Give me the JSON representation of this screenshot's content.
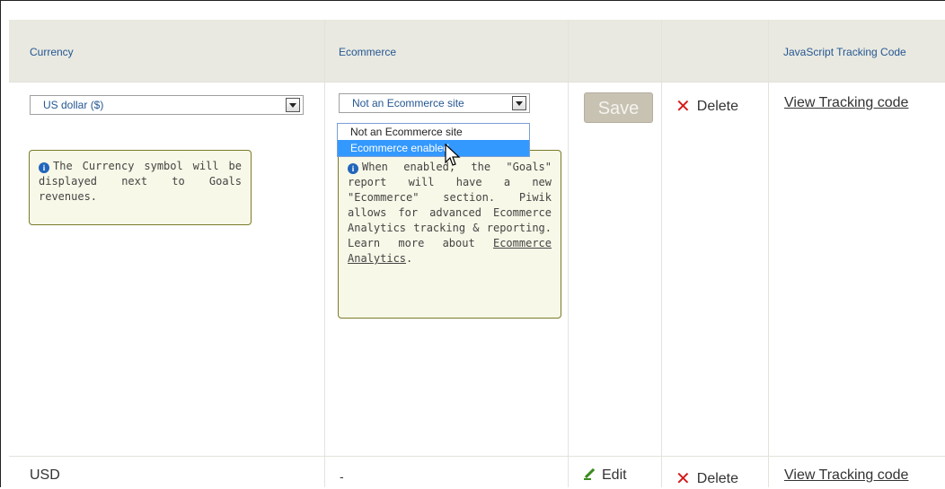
{
  "table": {
    "headers": {
      "currency": "Currency",
      "ecommerce": "Ecommerce",
      "tracking": "JavaScript Tracking Code"
    },
    "edit_row": {
      "currency_select": "US dollar ($)",
      "ecommerce_select": "Not an Ecommerce site",
      "currency_tip": "The Currency symbol will be displayed next to Goals revenues.",
      "ecommerce_tip_text": "When enabled, the \"Goals\" report will have a new \"Ecommerce\" section. Piwik allows for advanced Ecommerce Analytics tracking & reporting. Learn more about",
      "ecommerce_tip_link": "Ecommerce Analytics",
      "ecommerce_tip_end": ".",
      "save": "Save",
      "delete": "Delete",
      "view_tracking": "View Tracking code"
    },
    "dropdown_options": [
      "Not an Ecommerce site",
      "Ecommerce enabled"
    ],
    "row2": {
      "currency": "USD",
      "ecommerce": "-",
      "edit": "Edit",
      "delete": "Delete",
      "view_tracking": "View Tracking code"
    }
  },
  "icons": {
    "info": "info-icon",
    "delete": "close-icon",
    "edit": "pencil-icon",
    "select_arrow": "chevron-down-icon",
    "cursor": "mouse-pointer-icon"
  },
  "colors": {
    "header_bg": "#e9e9e1",
    "header_text": "#255792",
    "delete_red": "#d41a1a",
    "selected_option": "#3399ff"
  }
}
